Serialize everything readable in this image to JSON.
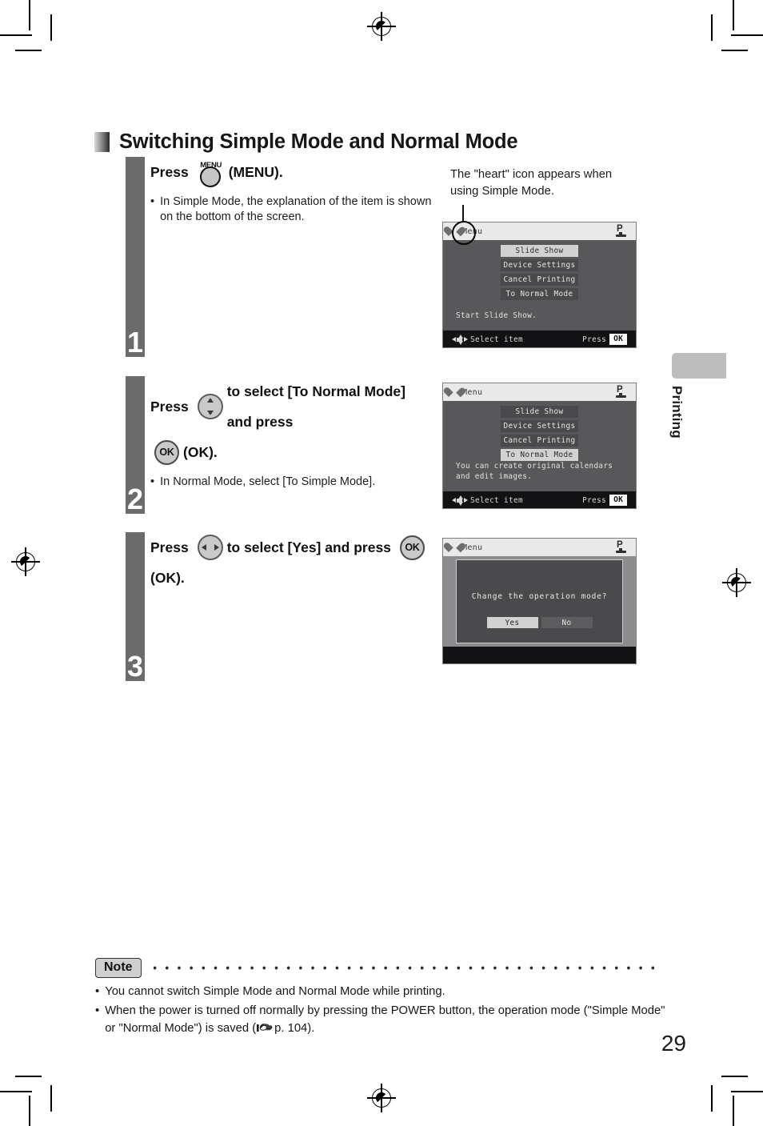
{
  "page": {
    "number": "29",
    "side_tab": "Printing"
  },
  "heading": {
    "title": "Switching Simple Mode and Normal Mode",
    "icon": "gradient-square"
  },
  "callout": {
    "text": "The \"heart\" icon appears when using Simple Mode."
  },
  "steps": [
    {
      "number": "1",
      "title_pre": "Press",
      "button_label": "MENU",
      "title_post": "(MENU).",
      "bullet": "In Simple Mode, the explanation of the item is shown on the bottom of the screen."
    },
    {
      "number": "2",
      "title_pre": "Press",
      "title_mid": "to select [To Normal Mode] and press",
      "ok_label": "OK",
      "title_post": "(OK).",
      "bullet": "In Normal Mode, select [To Simple Mode]."
    },
    {
      "number": "3",
      "title_pre": "Press",
      "title_mid": "to select [Yes] and press",
      "ok_label": "OK",
      "title_post": "(OK).",
      "bullet": ""
    }
  ],
  "screens": [
    {
      "title": "Menu",
      "status_icon": "printer-p-icon",
      "items": [
        {
          "label": "Slide Show",
          "selected": true
        },
        {
          "label": "Device Settings",
          "selected": false
        },
        {
          "label": "Cancel Printing",
          "selected": false
        },
        {
          "label": "To Normal Mode",
          "selected": false
        }
      ],
      "description": "Start Slide Show.",
      "footer_left": "Select item",
      "footer_right": "Press",
      "footer_ok": "OK"
    },
    {
      "title": "Menu",
      "status_icon": "printer-p-icon",
      "items": [
        {
          "label": "Slide Show",
          "selected": false
        },
        {
          "label": "Device Settings",
          "selected": false
        },
        {
          "label": "Cancel Printing",
          "selected": false
        },
        {
          "label": "To Normal Mode",
          "selected": true
        }
      ],
      "description": "You can create original calendars and edit images.",
      "footer_left": "Select item",
      "footer_right": "Press",
      "footer_ok": "OK"
    },
    {
      "title": "Menu",
      "status_icon": "printer-p-icon",
      "dialog_question": "Change the operation mode?",
      "dialog_buttons": [
        {
          "label": "Yes",
          "selected": true
        },
        {
          "label": "No",
          "selected": false
        }
      ]
    }
  ],
  "note": {
    "badge": "Note",
    "items_pre": [
      "You cannot switch Simple Mode and Normal Mode while printing."
    ],
    "item2_pre": "When the power is turned off normally by pressing the POWER button, the operation mode (\"Simple Mode\" or \"Normal Mode\") is saved (",
    "item2_ref": "p. 104).",
    "bullet": "•"
  }
}
